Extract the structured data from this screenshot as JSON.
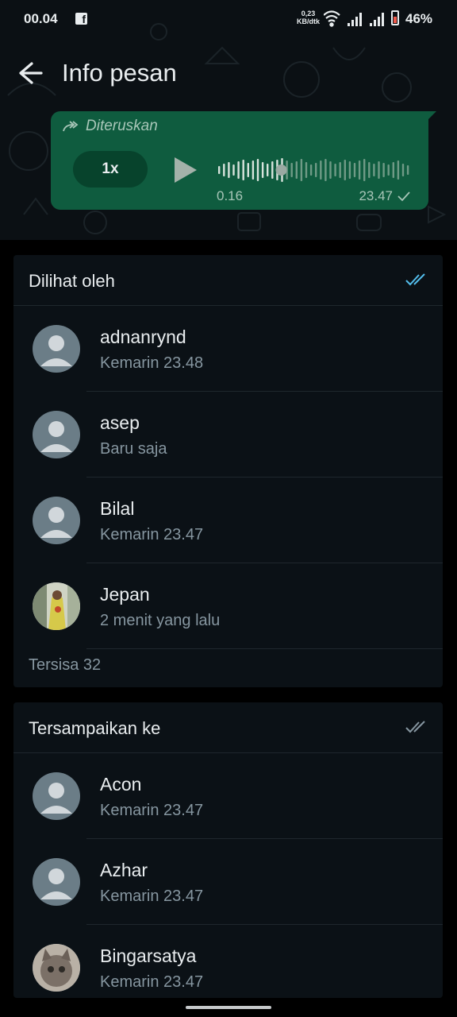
{
  "status_bar": {
    "time": "00.04",
    "net_speed_value": "0,23",
    "net_speed_unit": "KB/dtk",
    "battery": "46%"
  },
  "header": {
    "title": "Info pesan"
  },
  "message": {
    "forwarded_label": "Diteruskan",
    "speed": "1x",
    "elapsed": "0.16",
    "time": "23.47",
    "progress": 0.33
  },
  "seen_section": {
    "title": "Dilihat oleh",
    "items": [
      {
        "name": "adnanrynd",
        "time": "Kemarin 23.48"
      },
      {
        "name": "asep",
        "time": "Baru saja"
      },
      {
        "name": "Bilal",
        "time": "Kemarin 23.47"
      },
      {
        "name": "Jepan",
        "time": "2 menit yang lalu"
      }
    ],
    "remaining": "Tersisa 32"
  },
  "delivered_section": {
    "title": "Tersampaikan ke",
    "items": [
      {
        "name": "Acon",
        "time": "Kemarin 23.47"
      },
      {
        "name": "Azhar",
        "time": "Kemarin 23.47"
      },
      {
        "name": "Bingarsatya",
        "time": "Kemarin 23.47"
      }
    ]
  },
  "colors": {
    "read_tick": "#53bdeb",
    "bubble": "#0f5c3f",
    "card": "#0b1116"
  }
}
